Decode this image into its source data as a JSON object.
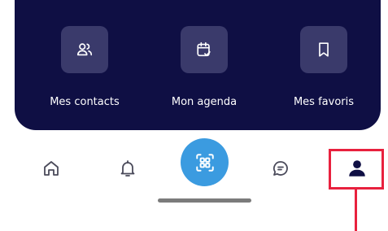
{
  "shortcuts": [
    {
      "label": "Mes contacts",
      "icon": "contacts-icon"
    },
    {
      "label": "Mon agenda",
      "icon": "calendar-check-icon"
    },
    {
      "label": "Mes favoris",
      "icon": "bookmark-icon"
    }
  ],
  "tabbar": {
    "items": [
      {
        "name": "home",
        "icon": "home-icon"
      },
      {
        "name": "notifications",
        "icon": "bell-icon"
      },
      {
        "name": "scan",
        "icon": "qr-scan-icon"
      },
      {
        "name": "messages",
        "icon": "chat-icon"
      },
      {
        "name": "profile",
        "icon": "user-icon",
        "selected": true
      }
    ]
  },
  "colors": {
    "panel": "#0f0f44",
    "tile": "#3a3a6b",
    "scan_button": "#3b9be0",
    "highlight": "#e8213e"
  }
}
